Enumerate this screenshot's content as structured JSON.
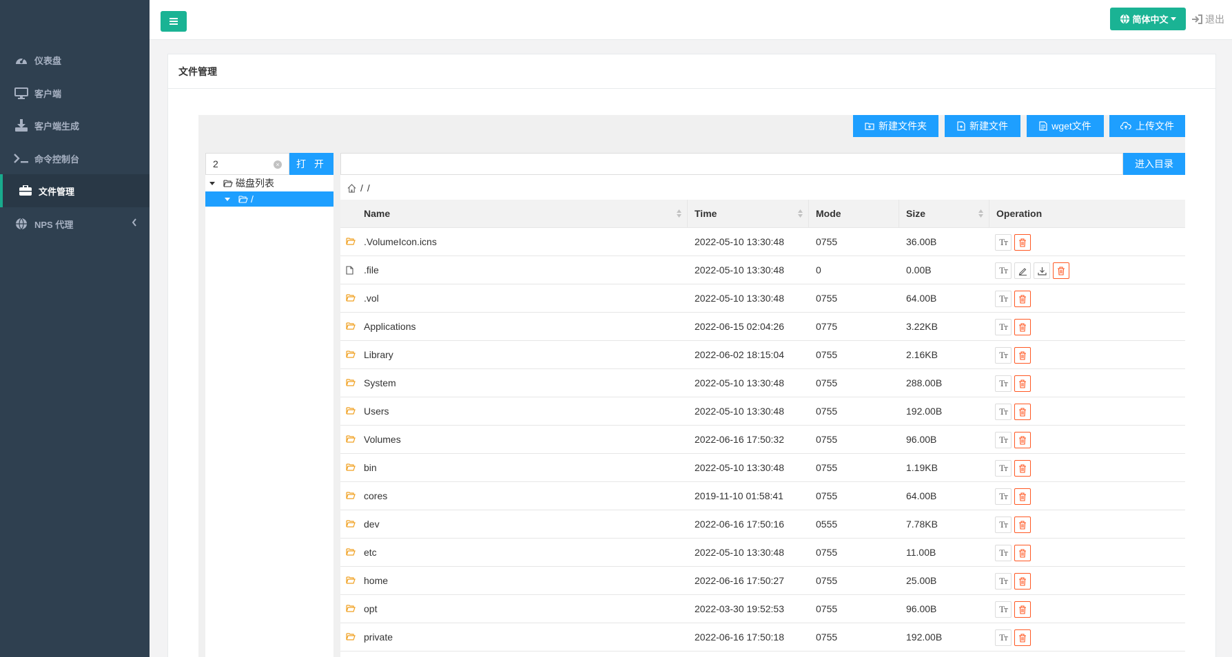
{
  "sidebar": {
    "items": [
      {
        "label": "仪表盘",
        "icon": "dashboard-icon",
        "active": false
      },
      {
        "label": "客户端",
        "icon": "monitor-icon",
        "active": false
      },
      {
        "label": "客户端生成",
        "icon": "download-icon",
        "active": false
      },
      {
        "label": "命令控制台",
        "icon": "terminal-icon",
        "active": false
      },
      {
        "label": "文件管理",
        "icon": "briefcase-icon",
        "active": true
      },
      {
        "label": "NPS 代理",
        "icon": "globe-icon",
        "active": false
      }
    ]
  },
  "topbar": {
    "menu_icon": "hamburger-icon",
    "language_label": "简体中文",
    "logout_label": "退出"
  },
  "panel": {
    "title": "文件管理"
  },
  "toolbar": {
    "new_folder": "新建文件夹",
    "new_file": "新建文件",
    "wget_file": "wget文件",
    "upload_file": "上传文件"
  },
  "tree": {
    "input_value": "2",
    "open_label": "打 开",
    "root_label": "磁盘列表",
    "child_label": "/"
  },
  "path": {
    "input_value": "",
    "enter_label": "进入目录",
    "breadcrumb": [
      "/",
      "/"
    ]
  },
  "table": {
    "columns": [
      "Name",
      "Time",
      "Mode",
      "Size",
      "Operation"
    ],
    "rows": [
      {
        "type": "folder",
        "name": ".VolumeIcon.icns",
        "time": "2022-05-10 13:30:48",
        "mode": "0755",
        "size": "36.00B"
      },
      {
        "type": "file",
        "name": ".file",
        "time": "2022-05-10 13:30:48",
        "mode": "0",
        "size": "0.00B"
      },
      {
        "type": "folder",
        "name": ".vol",
        "time": "2022-05-10 13:30:48",
        "mode": "0755",
        "size": "64.00B"
      },
      {
        "type": "folder",
        "name": "Applications",
        "time": "2022-06-15 02:04:26",
        "mode": "0775",
        "size": "3.22KB"
      },
      {
        "type": "folder",
        "name": "Library",
        "time": "2022-06-02 18:15:04",
        "mode": "0755",
        "size": "2.16KB"
      },
      {
        "type": "folder",
        "name": "System",
        "time": "2022-05-10 13:30:48",
        "mode": "0755",
        "size": "288.00B"
      },
      {
        "type": "folder",
        "name": "Users",
        "time": "2022-05-10 13:30:48",
        "mode": "0755",
        "size": "192.00B"
      },
      {
        "type": "folder",
        "name": "Volumes",
        "time": "2022-06-16 17:50:32",
        "mode": "0755",
        "size": "96.00B"
      },
      {
        "type": "folder",
        "name": "bin",
        "time": "2022-05-10 13:30:48",
        "mode": "0755",
        "size": "1.19KB"
      },
      {
        "type": "folder",
        "name": "cores",
        "time": "2019-11-10 01:58:41",
        "mode": "0755",
        "size": "64.00B"
      },
      {
        "type": "folder",
        "name": "dev",
        "time": "2022-06-16 17:50:16",
        "mode": "0555",
        "size": "7.78KB"
      },
      {
        "type": "folder",
        "name": "etc",
        "time": "2022-05-10 13:30:48",
        "mode": "0755",
        "size": "11.00B"
      },
      {
        "type": "folder",
        "name": "home",
        "time": "2022-06-16 17:50:27",
        "mode": "0755",
        "size": "25.00B"
      },
      {
        "type": "folder",
        "name": "opt",
        "time": "2022-03-30 19:52:53",
        "mode": "0755",
        "size": "96.00B"
      },
      {
        "type": "folder",
        "name": "private",
        "time": "2022-06-16 17:50:18",
        "mode": "0755",
        "size": "192.00B"
      }
    ]
  },
  "colors": {
    "sidebar_bg": "#2f4050",
    "accent_green": "#1ab394",
    "accent_blue": "#1e9fff",
    "danger": "#ff5722",
    "folder": "#f0a020"
  }
}
